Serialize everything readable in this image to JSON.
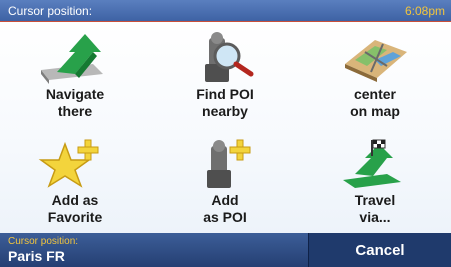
{
  "header": {
    "title": "Cursor position:",
    "time": "6:08pm"
  },
  "menu": [
    {
      "line1": "Navigate",
      "line2": "there",
      "icon": "navigate-arrow-icon"
    },
    {
      "line1": "Find POI",
      "line2": "nearby",
      "icon": "poi-search-icon"
    },
    {
      "line1": "center",
      "line2": "on map",
      "icon": "map-center-icon"
    },
    {
      "line1": "Add as",
      "line2": "Favorite",
      "icon": "favorite-star-icon"
    },
    {
      "line1": "Add",
      "line2": "as POI",
      "icon": "add-poi-icon"
    },
    {
      "line1": "Travel",
      "line2": "via...",
      "icon": "travel-via-icon"
    }
  ],
  "footer": {
    "label": "Cursor position:",
    "value": "Paris FR",
    "cancel_label": "Cancel"
  },
  "colors": {
    "accent_yellow": "#f2c53d",
    "header_blue": "#4a6fb0",
    "footer_blue": "#253f73"
  }
}
